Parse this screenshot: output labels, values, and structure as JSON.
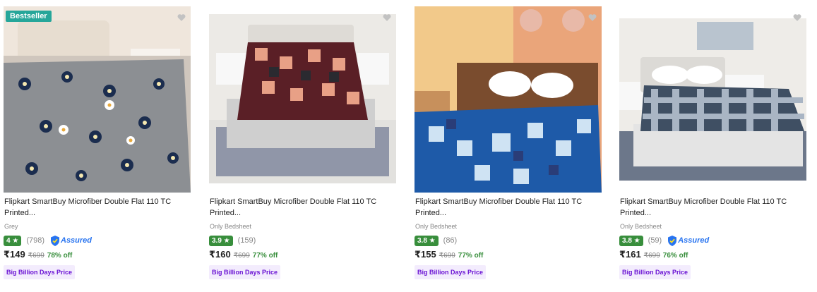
{
  "products": [
    {
      "badge": "Bestseller",
      "title_line1": "Flipkart SmartBuy Microfiber Double Flat 110 TC",
      "title_line2": "Printed...",
      "subtitle": "Grey",
      "rating": "4 ★",
      "reviews": "(798)",
      "assured": "Assured",
      "price": "₹149",
      "mrp": "₹699",
      "discount": "78% off",
      "deal": "Big Billion Days Price"
    },
    {
      "title_line1": "Flipkart SmartBuy Microfiber Double Flat 110 TC",
      "title_line2": "Printed...",
      "subtitle": "Only Bedsheet",
      "rating": "3.9 ★",
      "reviews": "(159)",
      "price": "₹160",
      "mrp": "₹699",
      "discount": "77% off",
      "deal": "Big Billion Days Price"
    },
    {
      "title_line1": "Flipkart SmartBuy Microfiber Double Flat 110 TC",
      "title_line2": "Printed...",
      "subtitle": "Only Bedsheet",
      "rating": "3.8 ★",
      "reviews": "(86)",
      "price": "₹155",
      "mrp": "₹699",
      "discount": "77% off",
      "deal": "Big Billion Days Price"
    },
    {
      "title_line1": "Flipkart SmartBuy Microfiber Double Flat 110 TC",
      "title_line2": "Printed...",
      "subtitle": "Only Bedsheet",
      "rating": "3.8 ★",
      "reviews": "(59)",
      "assured": "Assured",
      "price": "₹161",
      "mrp": "₹699",
      "discount": "76% off",
      "deal": "Big Billion Days Price"
    }
  ],
  "colors": {
    "rating_green": "#388e3c",
    "bestseller_teal": "#26a69a",
    "deal_purple": "#6b14d4",
    "assured_blue": "#2874f0"
  }
}
